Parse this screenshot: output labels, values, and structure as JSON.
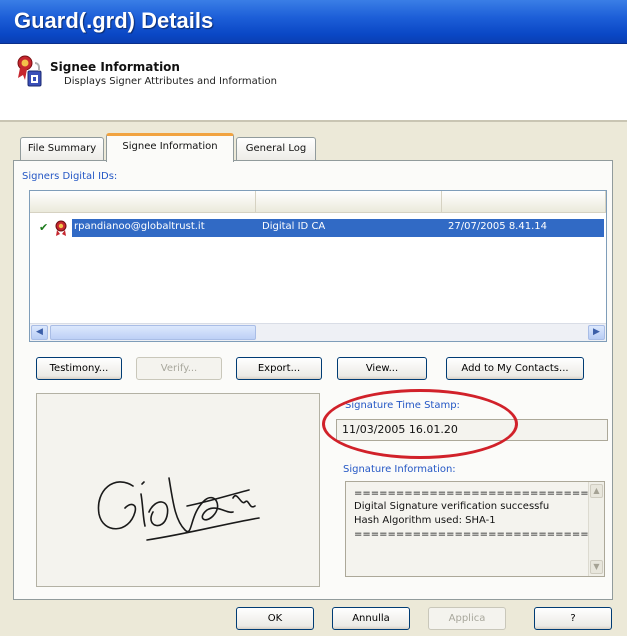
{
  "window": {
    "title": "Guard(.grd) Details"
  },
  "header": {
    "title": "Signee Information",
    "description": "Displays Signer Attributes and Information",
    "icon": "certificate-icon"
  },
  "tabs": [
    {
      "label": "File Summary",
      "active": false
    },
    {
      "label": "Signee Information",
      "active": true
    },
    {
      "label": "General Log",
      "active": false
    }
  ],
  "signers": {
    "group_label": "Signers Digital IDs:",
    "columns": [
      "",
      "",
      ""
    ],
    "rows": [
      {
        "checked": true,
        "email": "rpandianoo@globaltrust.it",
        "issuer": "Digital ID CA",
        "date": "27/07/2005 8.41.14",
        "selected": true
      }
    ]
  },
  "buttons": {
    "testimony": "Testimony...",
    "verify": "Verify...",
    "export": "Export...",
    "view": "View...",
    "add_contacts": "Add to My Contacts..."
  },
  "timestamp": {
    "label": "Signature Time Stamp:",
    "value": "11/03/2005 16.01.20"
  },
  "signature_info": {
    "label": "Signature Information:",
    "lines": [
      "================================",
      "Digital Signature verification successfu",
      "Hash Algorithm used: SHA-1",
      "================================"
    ]
  },
  "footer": {
    "ok": "OK",
    "cancel": "Annulla",
    "apply": "Applica",
    "help": "?"
  },
  "colors": {
    "title_bar": "#0a47c5",
    "selection": "#316ac5",
    "highlight_ellipse": "#d1212a",
    "group_label": "#2457c5"
  }
}
